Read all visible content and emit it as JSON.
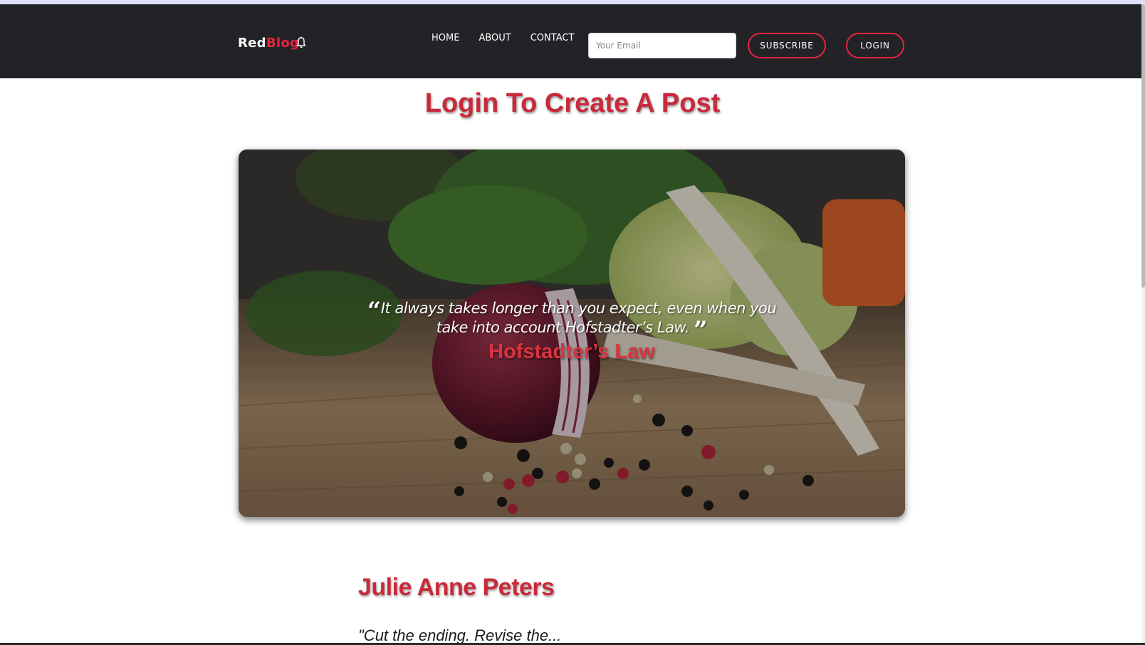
{
  "navbar": {
    "brand_red": "Red",
    "brand_blog": "Blog",
    "links": [
      "HOME",
      "ABOUT",
      "CONTACT"
    ],
    "email_placeholder": "Your Email",
    "subscribe_label": "SUBSCRIBE",
    "login_label": "LOGIN"
  },
  "main": {
    "page_title": "Login To Create A Post"
  },
  "hero": {
    "quote": "It always takes longer than you expect, even when you take into account Hofstadter’s Law.",
    "quote_author": "Hofstadter’s Law",
    "image": "vegetables-cutting-board"
  },
  "post": {
    "author": "Julie Anne Peters",
    "excerpt": "\"Cut the ending. Revise the..."
  },
  "colors": {
    "accent": "#e8243c",
    "title": "#c92a3a",
    "navbar_bg": "#232227"
  }
}
